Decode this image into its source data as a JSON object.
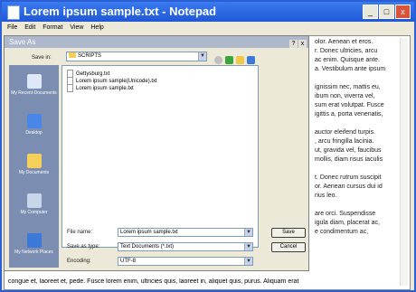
{
  "window": {
    "title": "Lorem ipsum sample.txt - Notepad",
    "min_glyph": "_",
    "max_glyph": "□",
    "close_glyph": "x"
  },
  "menu": [
    "File",
    "Edit",
    "Format",
    "View",
    "Help"
  ],
  "editor": {
    "right_lines": [
      "olor. Aenean et eros.",
      "r. Donec ultricies, arcu",
      "ac enim. Quisque ante.",
      "a. Vestibulum ante ipsum",
      "",
      "ignissim nec, mattis eu,",
      "ibum non, viverra vel,",
      "sum erat volutpat. Fusce",
      "igittis a, porta venenatis,",
      "",
      "auctor eleifend turpis.",
      ", arcu fringilla lacinia.",
      "ut, gravida vel, faucibus",
      "mollis, diam risus iaculis",
      "",
      "t. Donec rutrum suscipit",
      "or. Aenean cursus dui id",
      "rius leo.",
      "",
      "are orci. Suspendisse",
      "igula diam, placerat ac,",
      "e condimentum ac,"
    ],
    "bottom_line": "congue et, laoreet et, pede. Fusce lorem enim, ultricies quis, laoreet in, aliquet quis, purus. Aliquam erat"
  },
  "dialog": {
    "title": "Save As",
    "help_glyph": "?",
    "close_glyph": "x",
    "save_in_label": "Save in:",
    "save_in_value": "SCRIPTS",
    "places": [
      "My Recent Documents",
      "Desktop",
      "My Documents",
      "My Computer",
      "My Network Places"
    ],
    "files": [
      "Gettysburg.txt",
      "Lorem ipsum sample(Unicode).txt",
      "Lorem ipsum sample.txt"
    ],
    "file_name_label": "File name:",
    "file_name_value": "Lorem ipsum sample.txt",
    "save_as_type_label": "Save as type:",
    "save_as_type_value": "Text Documents (*.txt)",
    "encoding_label": "Encoding:",
    "encoding_value": "UTF-8",
    "save_button": "Save",
    "cancel_button": "Cancel"
  }
}
